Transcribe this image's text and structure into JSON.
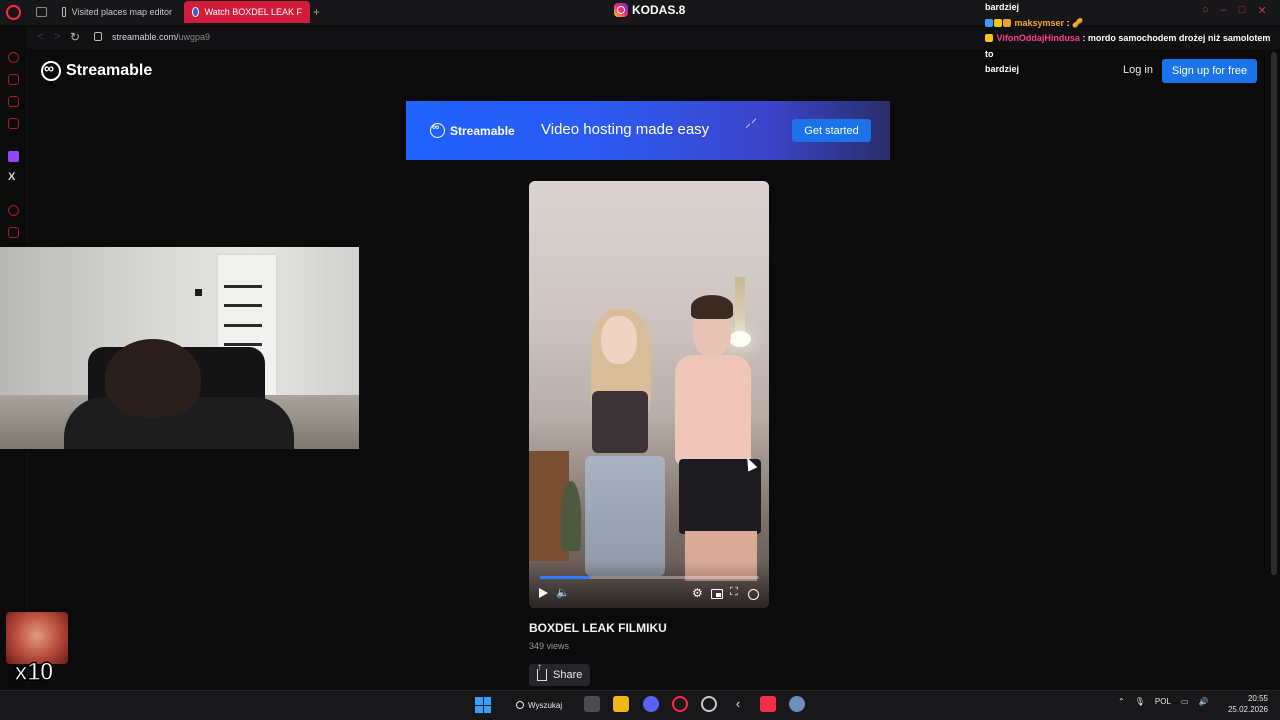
{
  "browser": {
    "tabs": [
      {
        "label": "Visited places map editor",
        "active": false
      },
      {
        "label": "Watch BOXDEL LEAK F",
        "active": true
      }
    ],
    "new_tab": "+",
    "url_host": "streamable.com/",
    "url_path": "uwgpa9"
  },
  "overlay": {
    "instagram_handle": "KODAS.8",
    "emote_multiplier": "x10"
  },
  "chat": [
    {
      "user": "",
      "user_color": "#ffffff",
      "message": "bardziej"
    },
    {
      "user": "maksymser",
      "user_color": "#f5a623",
      "message": ": 🥜"
    },
    {
      "user": "VifonOddajHindusa",
      "user_color": "#ff3b8d",
      "message": ": mordo samochodem drożej niż samolotem to"
    },
    {
      "user": "",
      "user_color": "#ffffff",
      "message": "bardziej"
    }
  ],
  "streamable": {
    "brand": "Streamable",
    "login_label": "Log in",
    "signup_label": "Sign up for free",
    "banner": {
      "brand": "Streamable",
      "tagline": "Video hosting made easy",
      "cta": "Get started"
    },
    "video": {
      "title": "BOXDEL LEAK FILMIKU",
      "views": "349 views",
      "progress": 0.23
    },
    "share_label": "Share"
  },
  "taskbar": {
    "search_label": "Wyszukaj",
    "language": "POL",
    "time": "20:55",
    "date": "25.02.2026"
  },
  "colors": {
    "opera_red": "#ff2a3d",
    "streamable_blue": "#1a73e8",
    "progress_blue": "#2f7bff"
  }
}
